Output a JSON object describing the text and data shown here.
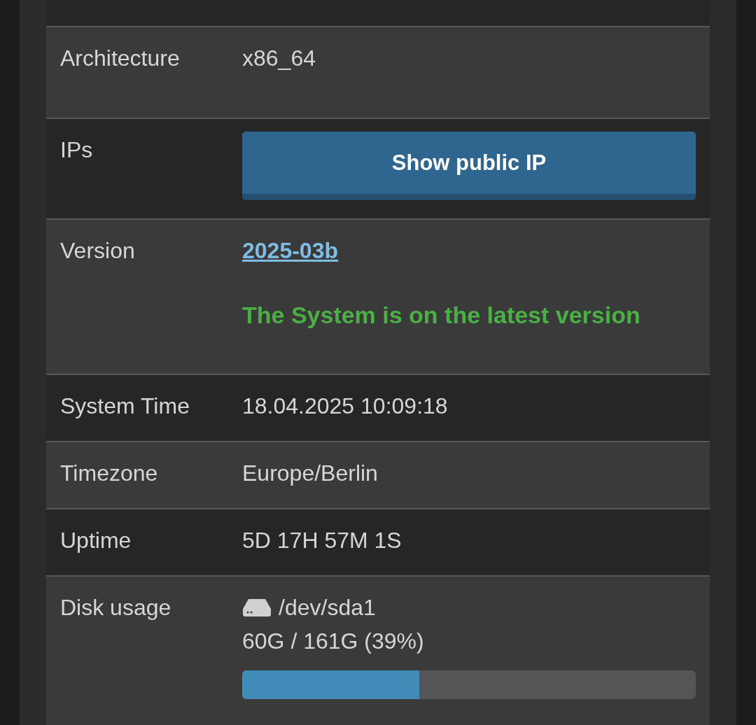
{
  "rows": [
    {
      "label": "Architecture",
      "kind": "text",
      "value": "x86_64"
    },
    {
      "label": "IPs",
      "kind": "button",
      "button": "Show public IP"
    },
    {
      "label": "Version",
      "kind": "version",
      "link": "2025-03b",
      "status": "The System is on the latest version"
    },
    {
      "label": "System Time",
      "kind": "text",
      "value": "18.04.2025 10:09:18"
    },
    {
      "label": "Timezone",
      "kind": "text",
      "value": "Europe/Berlin"
    },
    {
      "label": "Uptime",
      "kind": "text",
      "value": "5D 17H 57M 1S"
    },
    {
      "label": "Disk usage",
      "kind": "disk",
      "device": "/dev/sda1",
      "usage": "60G / 161G (39%)",
      "level": 0.39
    }
  ]
}
